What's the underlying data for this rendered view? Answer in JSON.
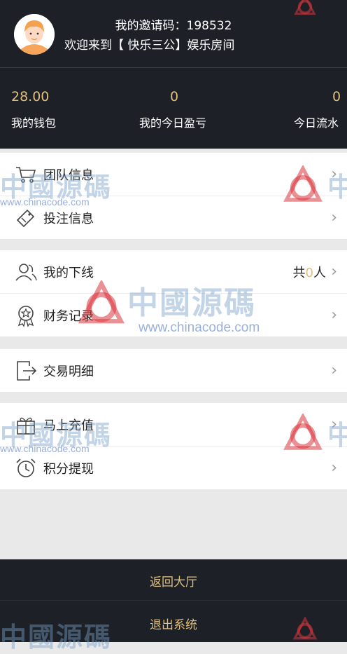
{
  "header": {
    "invite_label": "我的邀请码：",
    "invite_code": "198532",
    "welcome": "欢迎来到【 快乐三公】娱乐房间",
    "stats": [
      {
        "value": "28.00",
        "label": "我的钱包"
      },
      {
        "value": "0",
        "label": "我的今日盈亏"
      },
      {
        "value": "0",
        "label": "今日流水"
      }
    ]
  },
  "menu": {
    "team_info": "团队信息",
    "bet_info": "投注信息",
    "my_downline": "我的下线",
    "downline_prefix": "共",
    "downline_count": "0",
    "downline_suffix": "人",
    "finance_records": "财务记录",
    "transaction_details": "交易明细",
    "recharge": "马上充值",
    "points_withdraw": "积分提现",
    "arrow": "›"
  },
  "footer": {
    "return_lobby": "返回大厅",
    "logout": "退出系统"
  },
  "watermark": {
    "text": "中國源碼",
    "url": "www.chinacode.com"
  },
  "colors": {
    "header_bg": "#1d2026",
    "accent_gold": "#e1bf7c",
    "page_bg": "#e9e9e9",
    "watermark_red": "#d9363e"
  }
}
